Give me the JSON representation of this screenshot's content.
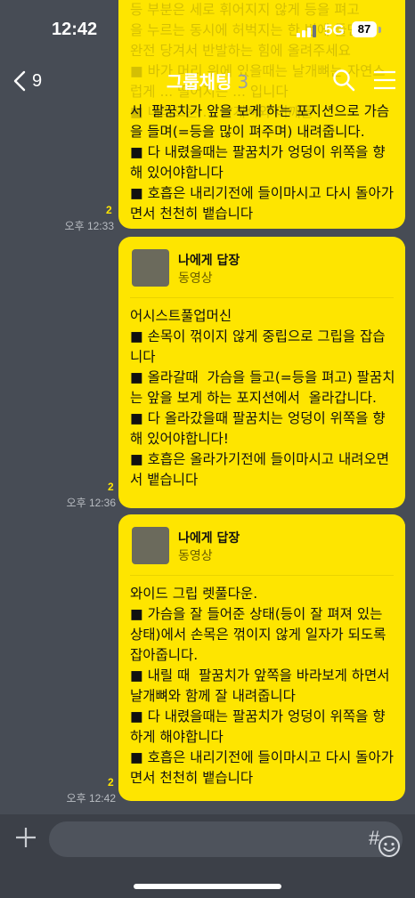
{
  "status": {
    "time": "12:42",
    "network": "5G",
    "battery": "87"
  },
  "header": {
    "back_count": "9",
    "title": "그룹채팅",
    "member_count": "3"
  },
  "messages": [
    {
      "faded": "등 부분은 세로 휘어지지 않게 등을 펴고\n을 누르는 동시에 허벅지는 한 번에 들면서\n완전 당겨서 반발하는 힘에 올려주세요\n■ 바가 머리 위에 있을때는 날개뼈는 자연스\n럽게 ... 떨어지는 ... 입니다\n■ 내려오는 ... 날개뼈와 어깨를",
      "text": "서  팔꿈치가 앞을 보게 하는 포지션으로 가슴을 들며(=등을 많이 펴주며) 내려줍니다.\n■ 다 내렸을때는 팔꿈치가 엉덩이 위쪽을 향해 있어야합니다\n■ 호흡은 내리기전에 들이마시고 다시 돌아가면서 천천히 뱉습니다",
      "unread": "2",
      "time": "오후 12:33"
    },
    {
      "reply_to": "나에게 답장",
      "reply_sender": "동영상",
      "text": "어시스트풀업머신\n■ 손목이 꺾이지 않게 중립으로 그립을 잡습니다\n■ 올라갈때  가슴을 들고(=등을 펴고) 팔꿈치는 앞을 보게 하는 포지션에서  올라갑니다.\n■ 다 올라갔을때 팔꿈치는 엉덩이 위쪽을 향해 있어야합니다!\n■ 호흡은 올라가기전에 들이마시고 내려오면서 뱉습니다",
      "unread": "2",
      "time": "오후 12:36"
    },
    {
      "reply_to": "나에게 답장",
      "reply_sender": "동영상",
      "text": "와이드 그립 렛풀다운.\n■ 가슴을 잘 들어준 상태(등이 잘 펴져 있는 상태)에서 손목은 꺾이지 않게 일자가 되도록 잡아줍니다.\n■ 내릴 때  팔꿈치가 앞쪽을 바라보게 하면서  날개뼈와 함께 잘 내려줍니다\n■ 다 내렸을때는 팔꿈치가 엉덩이 위쪽을 향하게 해야합니다\n■ 호흡은 내리기전에 들이마시고 다시 돌아가면서 천천히 뱉습니다",
      "unread": "2",
      "time": "오후 12:42"
    }
  ],
  "icons": {
    "back": "chevron-left-icon",
    "search": "search-icon",
    "menu": "hamburger-menu-icon",
    "plus": "plus-icon",
    "emoji": "emoji-icon",
    "hash": "#"
  },
  "colors": {
    "bubble": "#fee500",
    "background": "#474c55",
    "unread": "#fee500"
  }
}
